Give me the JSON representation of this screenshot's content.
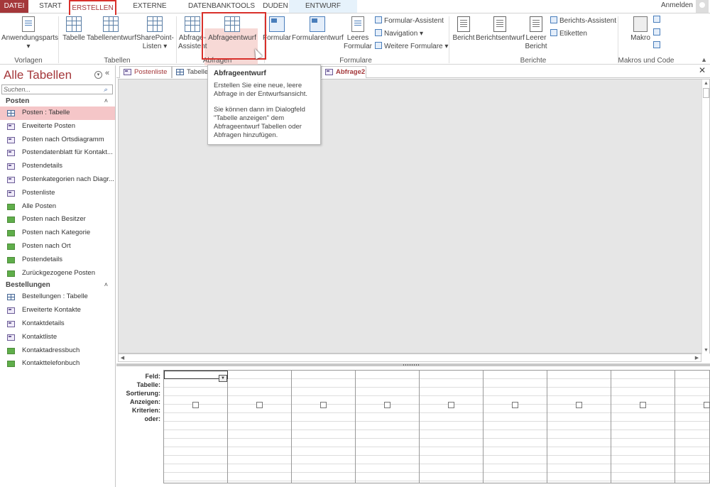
{
  "tabs": {
    "datei": "DATEI",
    "start": "START",
    "erstellen": "ERSTELLEN",
    "externe": "EXTERNE DATEN",
    "datenbank": "DATENBANKTOOLS",
    "duden": "DUDEN",
    "entwurf": "ENTWURF",
    "signin": "Anmelden"
  },
  "ribbon": {
    "anwendungsparts": "Anwendungsparts",
    "tabelle": "Tabelle",
    "tabellenentwurf": "Tabellenentwurf",
    "sharepoint_1": "SharePoint-",
    "sharepoint_2": "Listen",
    "abfrage_assistent_1": "Abfrage-",
    "abfrage_assistent_2": "Assistent",
    "abfrageentwurf": "Abfrageentwurf",
    "formular": "Formular",
    "formularentwurf": "Formularentwurf",
    "leeres_formular_1": "Leeres",
    "leeres_formular_2": "Formular",
    "formular_assistent": "Formular-Assistent",
    "navigation": "Navigation",
    "weitere_formulare": "Weitere Formulare",
    "bericht": "Bericht",
    "berichtsentwurf": "Berichtsentwurf",
    "leerer_bericht_1": "Leerer",
    "leerer_bericht_2": "Bericht",
    "berichts_assistent": "Berichts-Assistent",
    "etiketten": "Etiketten",
    "makro": "Makro",
    "groups": {
      "vorlagen": "Vorlagen",
      "tabellen": "Tabellen",
      "abfragen": "Abfragen",
      "formulare": "Formulare",
      "berichte": "Berichte",
      "makros": "Makros und Code"
    }
  },
  "nav": {
    "title": "Alle Tabellen",
    "search_placeholder": "Suchen...",
    "groups": [
      {
        "label": "Posten",
        "items": [
          {
            "label": "Posten : Tabelle",
            "icon": "table-icon"
          },
          {
            "label": "Erweiterte Posten",
            "icon": "form-icon"
          },
          {
            "label": "Posten nach Ortsdiagramm",
            "icon": "form-icon"
          },
          {
            "label": "Postendatenblatt für Kontakt...",
            "icon": "form-icon"
          },
          {
            "label": "Postendetails",
            "icon": "form-icon"
          },
          {
            "label": "Postenkategorien nach Diagr...",
            "icon": "form-icon"
          },
          {
            "label": "Postenliste",
            "icon": "form-icon"
          },
          {
            "label": "Alle Posten",
            "icon": "report-icon"
          },
          {
            "label": "Posten nach Besitzer",
            "icon": "report-icon"
          },
          {
            "label": "Posten nach Kategorie",
            "icon": "report-icon"
          },
          {
            "label": "Posten nach Ort",
            "icon": "report-icon"
          },
          {
            "label": "Postendetails",
            "icon": "report-icon"
          },
          {
            "label": "Zurückgezogene Posten",
            "icon": "report-icon"
          }
        ]
      },
      {
        "label": "Bestellungen",
        "items": [
          {
            "label": "Bestellungen : Tabelle",
            "icon": "table-icon"
          },
          {
            "label": "Erweiterte Kontakte",
            "icon": "form-icon"
          },
          {
            "label": "Kontaktdetails",
            "icon": "form-icon"
          },
          {
            "label": "Kontaktliste",
            "icon": "form-icon"
          },
          {
            "label": "Kontaktadressbuch",
            "icon": "report-icon"
          },
          {
            "label": "Kontakttelefonbuch",
            "icon": "report-icon"
          }
        ]
      }
    ]
  },
  "doctabs": {
    "postenliste": "Postenliste",
    "tabelle": "Tabelle",
    "abfrage2": "Abfrage2"
  },
  "grid": {
    "rows": [
      "Feld:",
      "Tabelle:",
      "Sortierung:",
      "Anzeigen:",
      "Kriterien:",
      "oder:"
    ]
  },
  "tooltip": {
    "title": "Abfrageentwurf",
    "text1": "Erstellen Sie eine neue, leere Abfrage in der Entwurfsansicht.",
    "text2": "Sie können dann im Dialogfeld \"Tabelle anzeigen\" dem Abfrageentwurf Tabellen oder Abfragen hinzufügen."
  },
  "colors": {
    "accent": "#a4373a",
    "highlight": "#d9302b",
    "selected": "#f5c6c8"
  }
}
